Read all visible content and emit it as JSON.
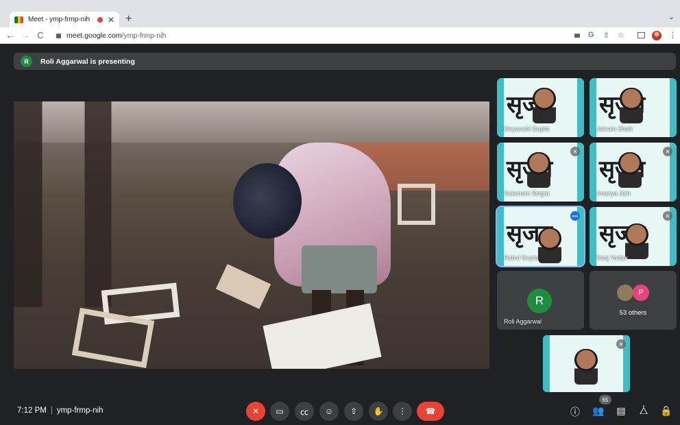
{
  "browser": {
    "tab_title": "Meet - ymp-frmp-nih",
    "url_host": "meet.google.com",
    "url_path": "/ymp-frmp-nih"
  },
  "presenting": {
    "avatar_letter": "R",
    "text": "Roli Aggarwal is presenting"
  },
  "participants": [
    {
      "name": "Divyanshi Gupta",
      "muted": false,
      "logo": "सृजन"
    },
    {
      "name": "Jainam Shah",
      "muted": false,
      "logo": "सृजन"
    },
    {
      "name": "Sukanam Singra",
      "muted": true,
      "logo": "सृजन"
    },
    {
      "name": "Ananya Jain",
      "muted": true,
      "logo": "सृजन"
    },
    {
      "name": "Rahul Gupta",
      "muted": false,
      "speaking": true,
      "logo": "सृजन"
    },
    {
      "name": "Saaj Yadav",
      "muted": true,
      "logo": "सृजन"
    }
  ],
  "presenter_tile": {
    "avatar_letter": "R",
    "name": "Roli Aggarwal"
  },
  "others_tile": {
    "avatar_letter": "P",
    "label": "53 others"
  },
  "bottom": {
    "time": "7:12 PM",
    "separator": "|",
    "meeting_code": "ymp-frmp-nih",
    "participant_count": "65"
  },
  "colors": {
    "background": "#202124",
    "hangup": "#ea4335",
    "accent": "#1a73e8",
    "avatar_green": "#1e8e3e",
    "avatar_pink": "#e8437a"
  }
}
